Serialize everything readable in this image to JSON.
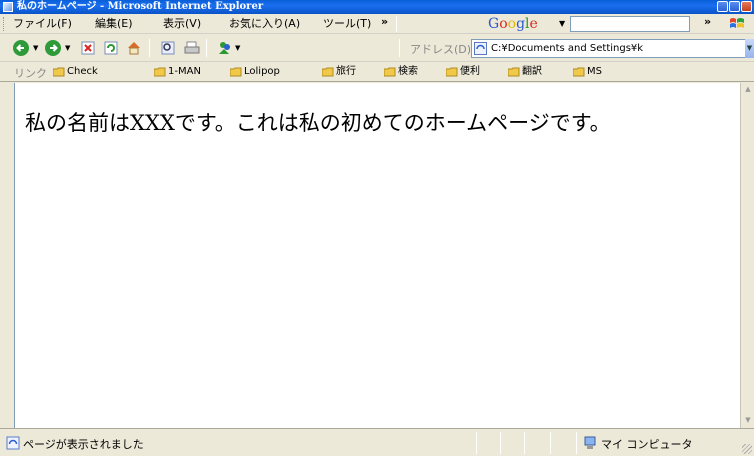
{
  "window": {
    "title": "私のホームページ - Microsoft Internet Explorer"
  },
  "menu": {
    "items": [
      "ファイル(F)",
      "編集(E)",
      "表示(V)",
      "お気に入り(A)",
      "ツール(T)"
    ],
    "overflow": "»",
    "google_label": "Google",
    "google_query": "",
    "overflow2": "»"
  },
  "toolbar": {
    "back_icon": "back-arrow-icon",
    "forward_icon": "forward-arrow-icon",
    "address_label": "アドレス(D)",
    "address_value": "C:¥Documents and Settings¥k"
  },
  "links": {
    "label": "リンク",
    "items": [
      "Check",
      "1-MAN",
      "Lolipop",
      "旅行",
      "検索",
      "便利",
      "翻訳",
      "MS"
    ]
  },
  "content": {
    "text": "私の名前はXXXです。これは私の初めてのホームページです。"
  },
  "status": {
    "text": "ページが表示されました",
    "zone": "マイ コンピュータ"
  },
  "colors": {
    "titlebar": "#0a5fd8",
    "chrome": "#ece9d8",
    "back_green": "#2f9a3a"
  }
}
